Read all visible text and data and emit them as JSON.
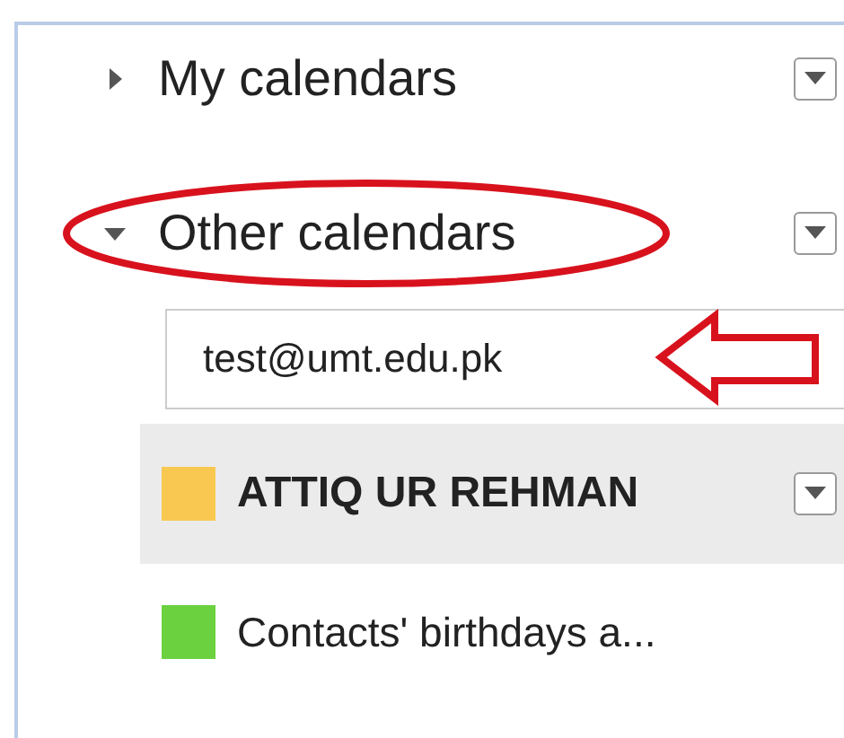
{
  "sections": [
    {
      "title": "My calendars",
      "expanded": false
    },
    {
      "title": "Other calendars",
      "expanded": true,
      "search": {
        "value": "test@umt.edu.pk"
      },
      "calendars": [
        {
          "name": "ATTIQ UR REHMAN",
          "color": "#f9c851",
          "selected": true
        },
        {
          "name": "Contacts' birthdays a...",
          "color": "#6bd13f",
          "selected": false
        }
      ]
    }
  ]
}
